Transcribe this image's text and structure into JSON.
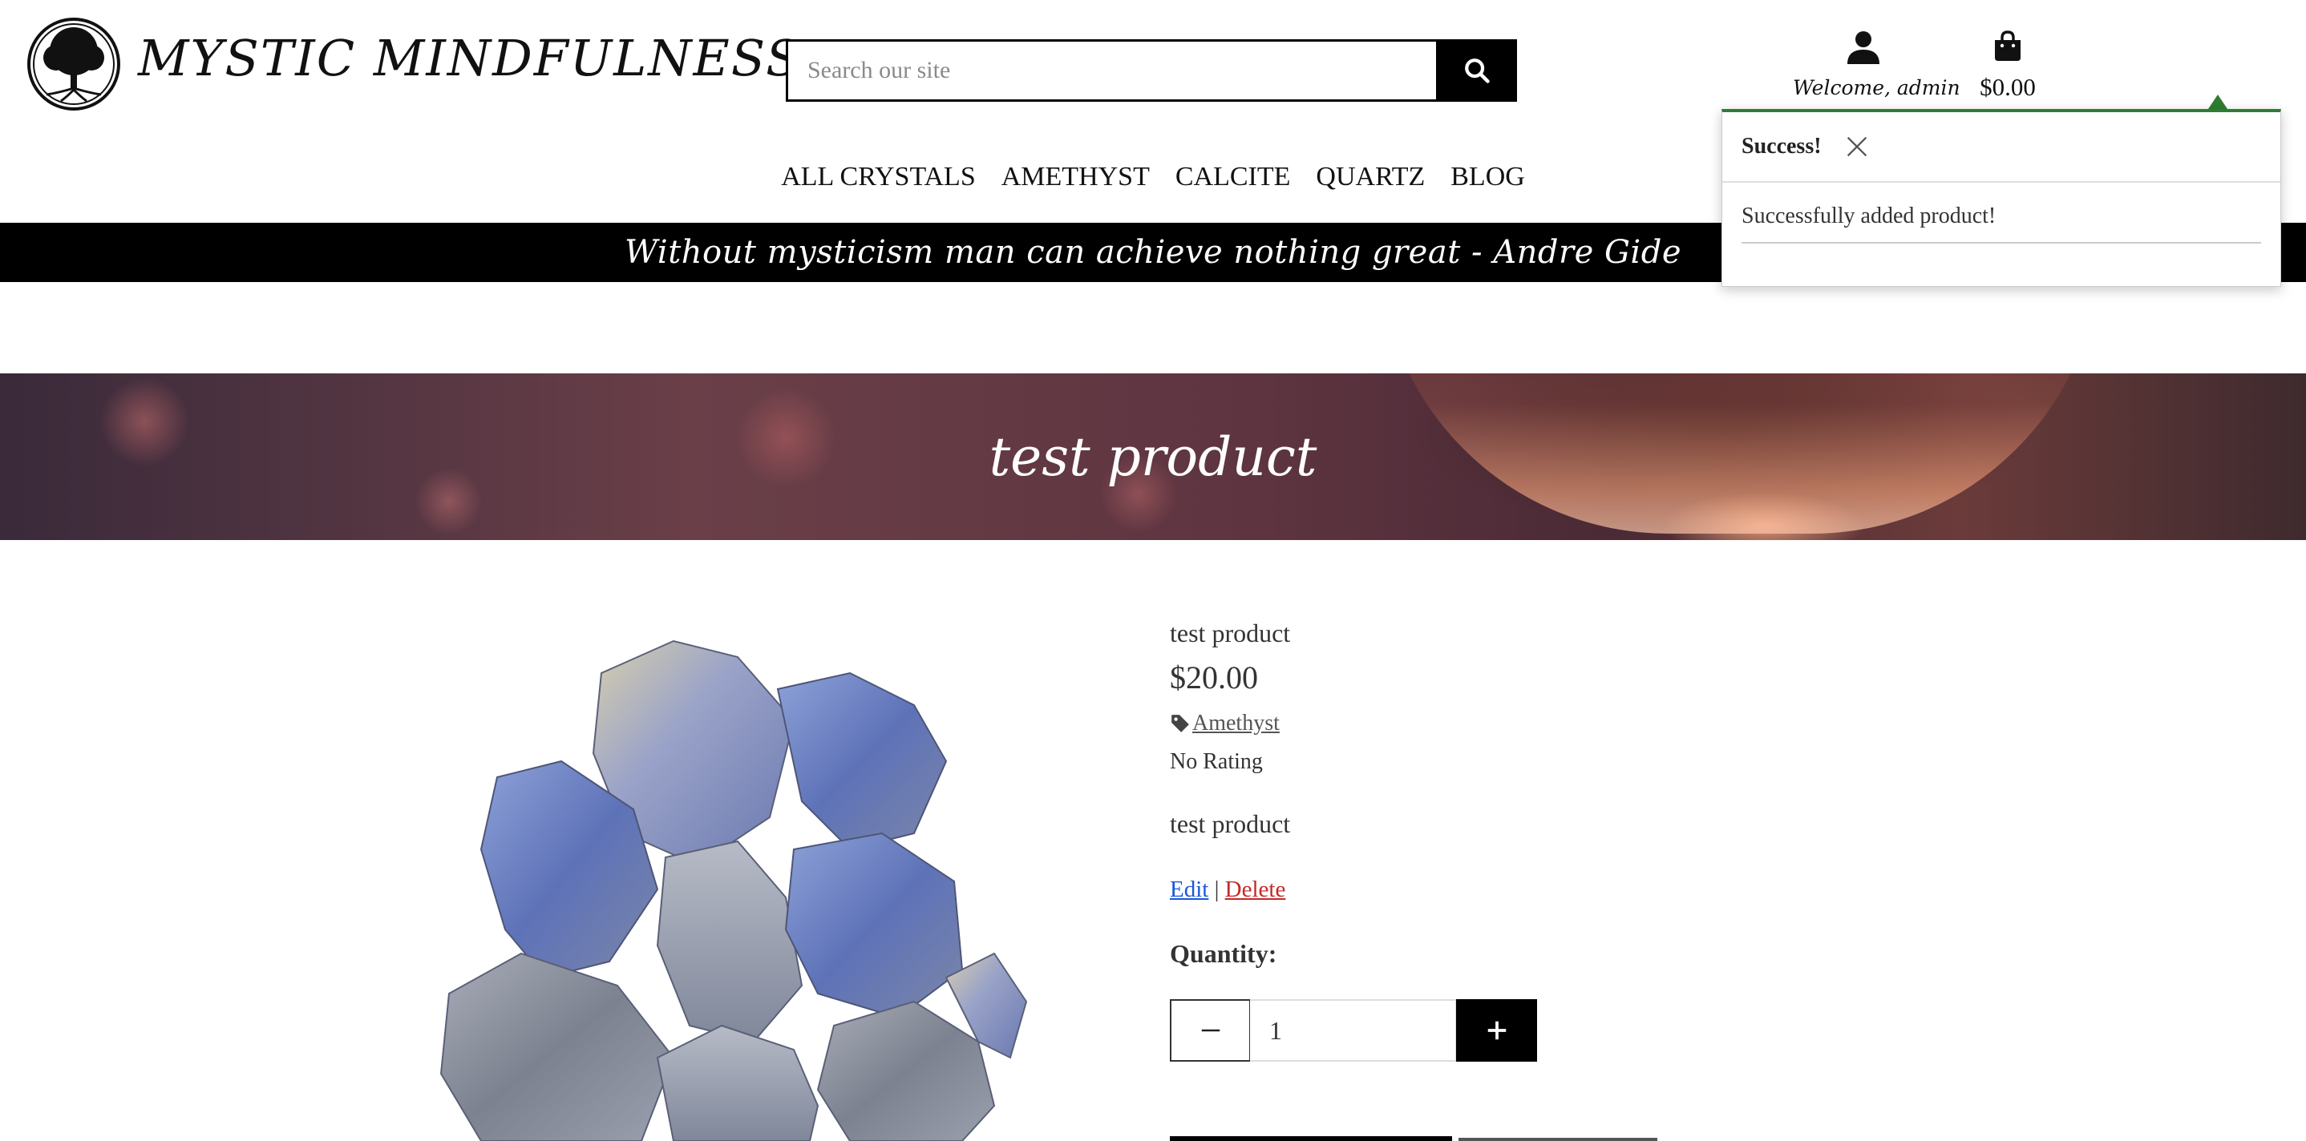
{
  "header": {
    "brand": "MYSTIC MINDFULNESS",
    "search": {
      "placeholder": "Search our site",
      "value": ""
    },
    "account_label": "Welcome, admin",
    "bag_total": "$0.00"
  },
  "nav": {
    "items": [
      "ALL CRYSTALS",
      "AMETHYST",
      "CALCITE",
      "QUARTZ",
      "BLOG"
    ]
  },
  "quote": "Without mysticism man can achieve nothing great - Andre Gide",
  "hero": {
    "title": "test product"
  },
  "product": {
    "name": "test product",
    "price": "$20.00",
    "category": "Amethyst",
    "rating": "No Rating",
    "description": "test product",
    "edit_label": "Edit",
    "separator": "|",
    "delete_label": "Delete",
    "quantity_label": "Quantity:",
    "quantity_value": "1"
  },
  "toast": {
    "title": "Success!",
    "message": "Successfully added product!",
    "accent_color": "#2e7d32"
  },
  "icons": [
    "tree-of-life-logo",
    "search-icon",
    "user-icon",
    "shopping-bag-icon",
    "tag-icon",
    "minus-icon",
    "plus-icon",
    "close-icon"
  ]
}
